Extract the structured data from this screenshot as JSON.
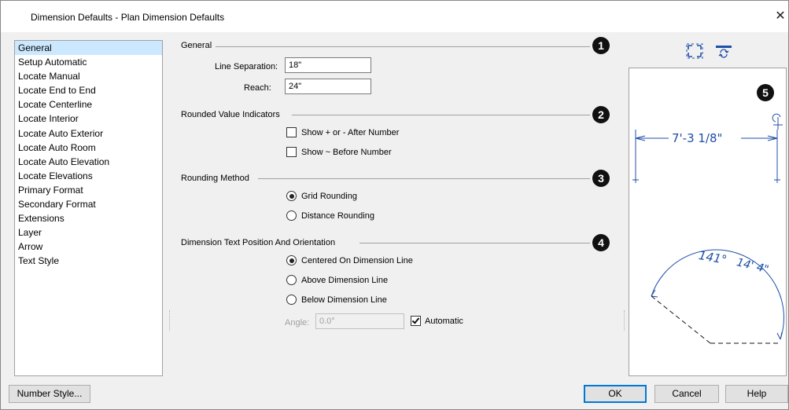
{
  "window": {
    "title": "Dimension Defaults - Plan Dimension Defaults",
    "close_glyph": "✕"
  },
  "sidebar": {
    "items": [
      {
        "label": "General",
        "selected": true
      },
      {
        "label": "Setup Automatic"
      },
      {
        "label": "Locate Manual"
      },
      {
        "label": "Locate End to End"
      },
      {
        "label": "Locate Centerline"
      },
      {
        "label": "Locate Interior"
      },
      {
        "label": "Locate Auto Exterior"
      },
      {
        "label": "Locate Auto Room"
      },
      {
        "label": "Locate Auto Elevation"
      },
      {
        "label": "Locate Elevations"
      },
      {
        "label": "Primary Format"
      },
      {
        "label": "Secondary Format"
      },
      {
        "label": "Extensions"
      },
      {
        "label": "Layer"
      },
      {
        "label": "Arrow"
      },
      {
        "label": "Text Style"
      }
    ]
  },
  "general": {
    "title": "General",
    "badge": "1",
    "line_separation_label": "Line Separation:",
    "line_separation_value": "18\"",
    "reach_label": "Reach:",
    "reach_value": "24\""
  },
  "rounded": {
    "title": "Rounded Value Indicators",
    "badge": "2",
    "show_plus_minus_label": "Show + or - After Number",
    "show_plus_minus_checked": false,
    "show_tilde_label": "Show ~ Before Number",
    "show_tilde_checked": false
  },
  "rounding": {
    "title": "Rounding Method",
    "badge": "3",
    "options": [
      "Grid Rounding",
      "Distance Rounding"
    ],
    "selected": "Grid Rounding"
  },
  "text_position": {
    "title": "Dimension Text Position And Orientation",
    "badge": "4",
    "options": [
      "Centered On Dimension Line",
      "Above Dimension Line",
      "Below Dimension Line"
    ],
    "selected": "Centered On Dimension Line",
    "angle_label": "Angle:",
    "angle_value": "0.0°",
    "automatic_label": "Automatic",
    "automatic_checked": true
  },
  "preview": {
    "badge": "5",
    "linear_dimension": "7'-3 1/8\"",
    "angle_text": "141°",
    "arc_text": "14' 4\"",
    "icons": [
      "fill-window-icon",
      "swap-preview-icon"
    ]
  },
  "footer": {
    "number_style_label": "Number Style...",
    "ok_label": "OK",
    "cancel_label": "Cancel",
    "help_label": "Help"
  },
  "colors": {
    "selection": "#cce8ff",
    "default_button_border": "#0078d7",
    "preview_ink": "#1f4fa8"
  }
}
